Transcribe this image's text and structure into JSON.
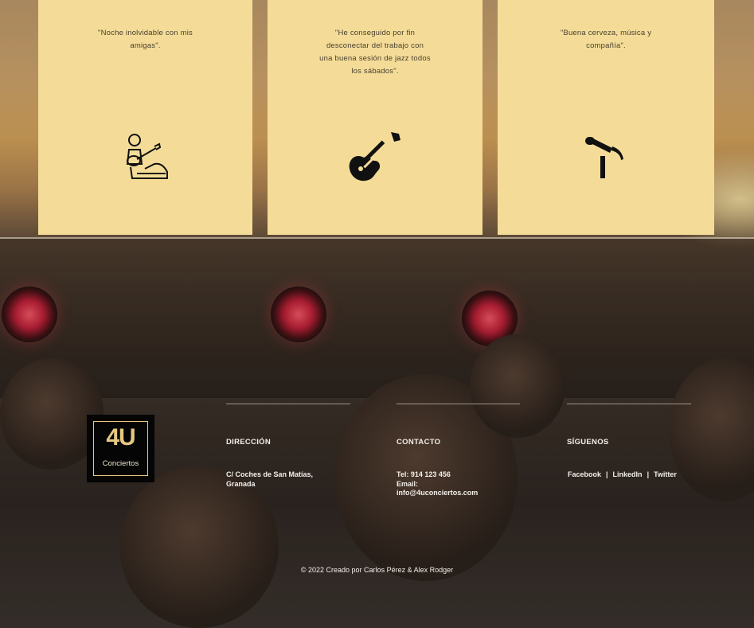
{
  "testimonials": [
    {
      "quote_lines": [
        "\"Noche inolvidable con mis",
        "amigas\"."
      ],
      "icon": "guitarist-icon"
    },
    {
      "quote_lines": [
        "\"He conseguido por fin",
        "desconectar del trabajo con",
        "una buena sesión de jazz todos",
        "los sábados\"."
      ],
      "icon": "electric-guitar-icon"
    },
    {
      "quote_lines": [
        "\"Buena cerveza, música y",
        "compañía\"."
      ],
      "icon": "microphone-icon"
    }
  ],
  "logo": {
    "mark": "4U",
    "sub": "Conciertos"
  },
  "footer": {
    "direccion": {
      "title": "DIRECCIÓN",
      "line1": "C/ Coches de San Matías,",
      "line2": "Granada"
    },
    "contacto": {
      "title": "CONTACTO",
      "tel": "Tel: 914 123 456",
      "email_label": "Email:",
      "email": "info@4uconciertos.com"
    },
    "siguenos": {
      "title": "SÍGUENOS",
      "links": [
        "Facebook",
        "LinkedIn",
        "Twitter"
      ],
      "separator": "|"
    },
    "copyright": "© 2022 Creado por Carlos Pérez & Alex Rodger"
  },
  "colors": {
    "card_bg": "#f4dc98",
    "logo_gold": "#e6c882",
    "footer_text": "#f3efe9"
  }
}
